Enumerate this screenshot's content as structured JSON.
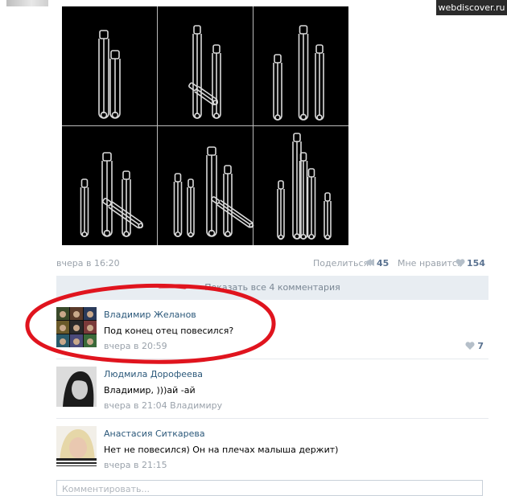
{
  "watermark": "webdiscover.ru",
  "post": {
    "date": "вчера в 16:20",
    "share_label": "Поделиться",
    "share_count": "45",
    "like_label": "Мне нравится",
    "like_count": "154",
    "show_all_comments": "Показать все 4 комментария"
  },
  "comments": [
    {
      "author": "Владимир Желанов",
      "text": "Под конец отец повесился?",
      "date": "вчера в 20:59",
      "likes": "7"
    },
    {
      "author": "Людмила Дорофеева",
      "text": "Владимир, )))ай -ай",
      "date": "вчера в 21:04",
      "reply_to": "Владимиру"
    },
    {
      "author": "Анастасия Ситкарева",
      "text": "Нет не повесился) Он на плечах малыша держит)",
      "date": "вчера в 21:15"
    }
  ],
  "comment_input": {
    "placeholder": "Комментировать..."
  },
  "colors": {
    "link": "#2b587a",
    "meta": "#9aa2ab",
    "count": "#5b7391",
    "annotation": "#e0141e",
    "show_all_bg": "#e8edf2"
  },
  "icons": [
    "megaphone-icon",
    "heart-icon"
  ]
}
